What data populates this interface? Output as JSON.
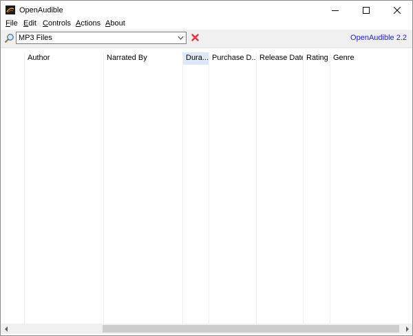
{
  "window": {
    "title": "OpenAudible",
    "min_icon": "minimize-icon",
    "max_icon": "maximize-icon",
    "close_icon": "close-icon"
  },
  "menu": [
    {
      "mnemonic": "F",
      "rest": "ile"
    },
    {
      "mnemonic": "E",
      "rest": "dit"
    },
    {
      "mnemonic": "C",
      "rest": "ontrols"
    },
    {
      "mnemonic": "A",
      "rest": "ctions"
    },
    {
      "mnemonic": "A",
      "rest": "bout",
      "mnemonic_index": 0
    }
  ],
  "toolbar": {
    "filter_value": "MP3 Files",
    "version": "OpenAudible 2.2",
    "accent": "#1a1adc"
  },
  "columns": [
    {
      "label": "Author"
    },
    {
      "label": "Narrated By"
    },
    {
      "label": "Dura..."
    },
    {
      "label": "Purchase D..."
    },
    {
      "label": "Release Date"
    },
    {
      "label": "Rating"
    },
    {
      "label": "Genre"
    }
  ]
}
